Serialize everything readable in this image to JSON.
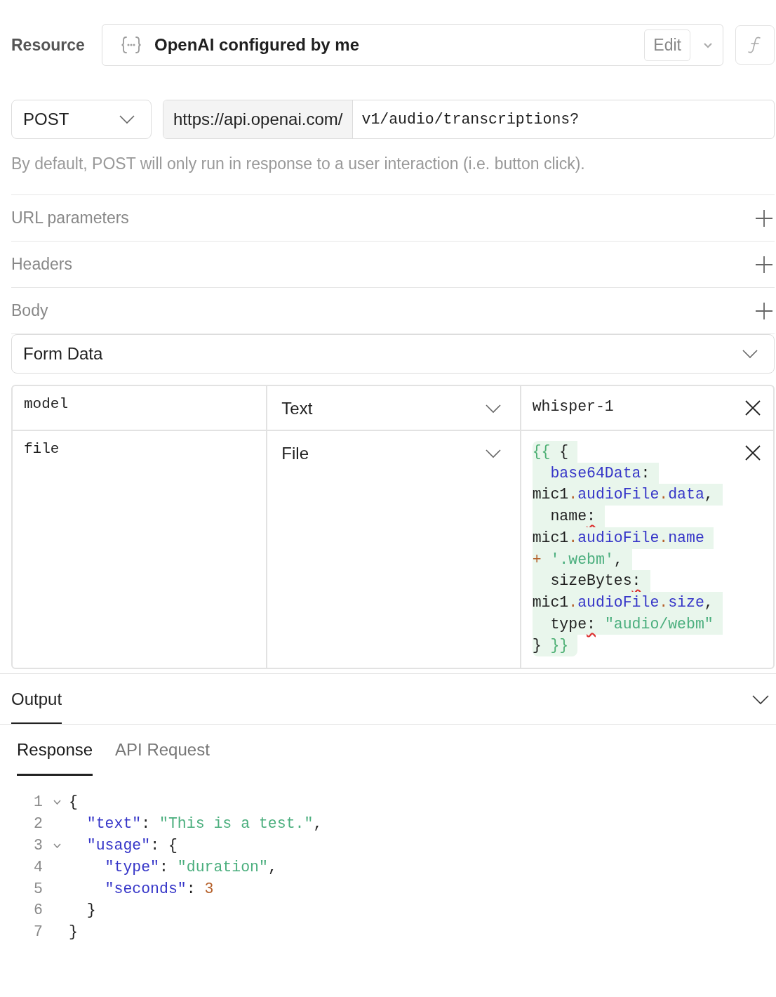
{
  "resource": {
    "label": "Resource",
    "value": "OpenAI configured by me",
    "edit_button": "Edit"
  },
  "request": {
    "method": "POST",
    "base_url": "https://api.openai.com/",
    "path": "v1/audio/transcriptions?",
    "hint": "By default, POST will only run in response to a user interaction (i.e. button click)."
  },
  "sections": [
    {
      "title": "URL parameters"
    },
    {
      "title": "Headers"
    },
    {
      "title": "Body"
    }
  ],
  "body": {
    "type": "Form Data",
    "rows": [
      {
        "key": "model",
        "type": "Text",
        "kind": "plain",
        "value": [
          [
            {
              "t": "whisper-1",
              "kind": "plain"
            }
          ]
        ]
      },
      {
        "key": "file",
        "type": "File",
        "kind": "template",
        "value": [
          [
            {
              "t": "{{",
              "kind": "tmpl"
            },
            {
              "t": " {",
              "kind": "plain"
            }
          ],
          [
            {
              "t": "  base64Data",
              "kind": "prop"
            },
            {
              "t": ":",
              "kind": "plain"
            }
          ],
          [
            {
              "t": "mic1",
              "kind": "plain"
            },
            {
              "t": ".",
              "kind": "op"
            },
            {
              "t": "audioFile",
              "kind": "prop"
            },
            {
              "t": ".",
              "kind": "op"
            },
            {
              "t": "data",
              "kind": "prop"
            },
            {
              "t": ",",
              "kind": "plain"
            }
          ],
          [
            {
              "t": "  name",
              "kind": "plain"
            },
            {
              "t": ":",
              "kind": "warn"
            }
          ],
          [
            {
              "t": "mic1",
              "kind": "plain"
            },
            {
              "t": ".",
              "kind": "op"
            },
            {
              "t": "audioFile",
              "kind": "prop"
            },
            {
              "t": ".",
              "kind": "op"
            },
            {
              "t": "name",
              "kind": "prop"
            }
          ],
          [
            {
              "t": "+",
              "kind": "op"
            },
            {
              "t": " '.webm'",
              "kind": "str"
            },
            {
              "t": ",",
              "kind": "plain"
            }
          ],
          [
            {
              "t": "  sizeBytes",
              "kind": "plain"
            },
            {
              "t": ":",
              "kind": "warn"
            }
          ],
          [
            {
              "t": "mic1",
              "kind": "plain"
            },
            {
              "t": ".",
              "kind": "op"
            },
            {
              "t": "audioFile",
              "kind": "prop"
            },
            {
              "t": ".",
              "kind": "op"
            },
            {
              "t": "size",
              "kind": "prop"
            },
            {
              "t": ",",
              "kind": "plain"
            }
          ],
          [
            {
              "t": "  type",
              "kind": "plain"
            },
            {
              "t": ":",
              "kind": "warn"
            },
            {
              "t": " \"audio/webm\"",
              "kind": "str"
            }
          ],
          [
            {
              "t": "} ",
              "kind": "plain"
            },
            {
              "t": "}}",
              "kind": "tmpl"
            }
          ]
        ]
      }
    ]
  },
  "output": {
    "title": "Output",
    "expanded": true,
    "tabs": [
      {
        "label": "Response",
        "selected": true
      },
      {
        "label": "API Request",
        "selected": false
      }
    ],
    "lines": [
      {
        "number": "1",
        "foldable": true,
        "tokens": [
          {
            "t": "{",
            "kind": "plain"
          }
        ]
      },
      {
        "number": "2",
        "foldable": false,
        "tokens": [
          {
            "t": "  \"text\"",
            "kind": "key"
          },
          {
            "t": ": ",
            "kind": "plain"
          },
          {
            "t": "\"This is a test.\"",
            "kind": "str"
          },
          {
            "t": ",",
            "kind": "plain"
          }
        ]
      },
      {
        "number": "3",
        "foldable": true,
        "tokens": [
          {
            "t": "  \"usage\"",
            "kind": "key"
          },
          {
            "t": ": {",
            "kind": "plain"
          }
        ]
      },
      {
        "number": "4",
        "foldable": false,
        "tokens": [
          {
            "t": "    \"type\"",
            "kind": "key"
          },
          {
            "t": ": ",
            "kind": "plain"
          },
          {
            "t": "\"duration\"",
            "kind": "str"
          },
          {
            "t": ",",
            "kind": "plain"
          }
        ]
      },
      {
        "number": "5",
        "foldable": false,
        "tokens": [
          {
            "t": "    \"seconds\"",
            "kind": "key"
          },
          {
            "t": ": ",
            "kind": "plain"
          },
          {
            "t": "3",
            "kind": "num"
          }
        ]
      },
      {
        "number": "6",
        "foldable": false,
        "tokens": [
          {
            "t": "  }",
            "kind": "plain"
          }
        ]
      },
      {
        "number": "7",
        "foldable": false,
        "tokens": [
          {
            "t": "}",
            "kind": "plain"
          }
        ]
      }
    ]
  }
}
